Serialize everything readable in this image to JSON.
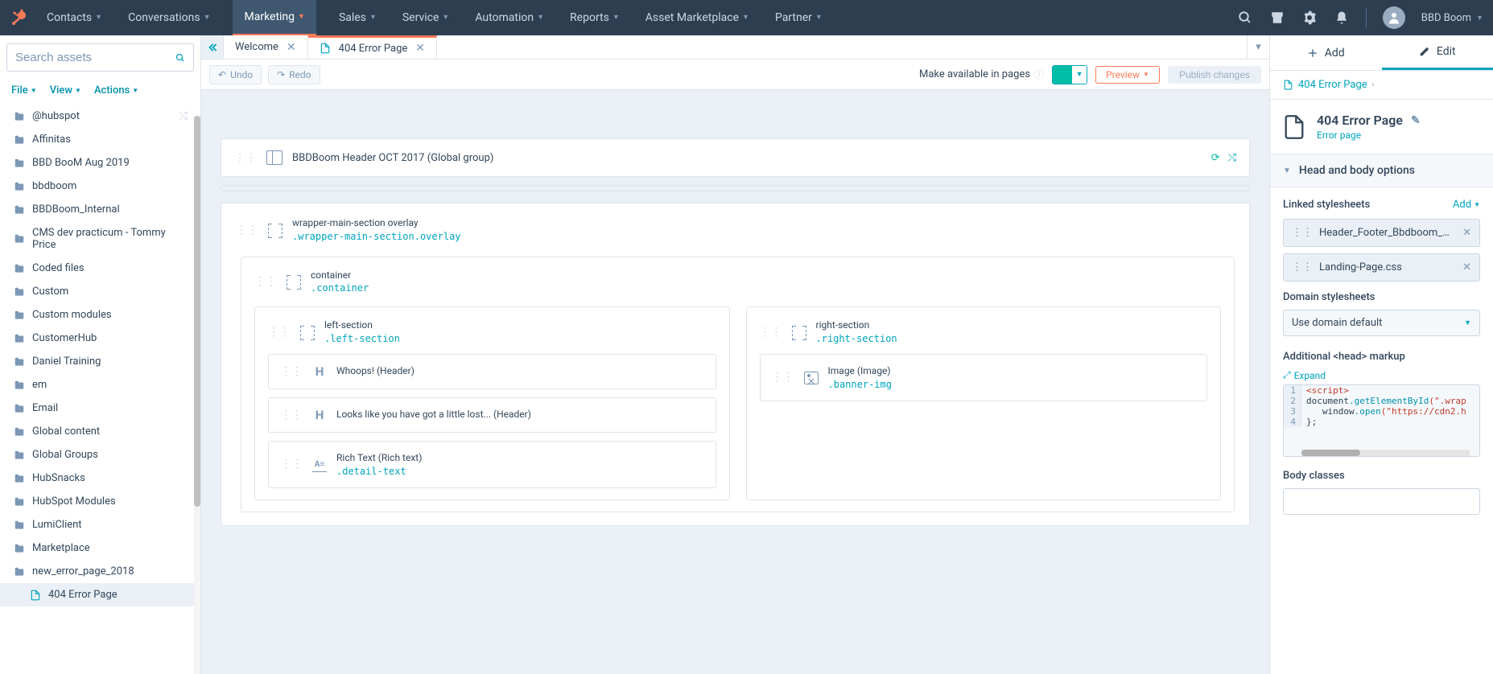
{
  "nav": {
    "items": [
      "Contacts",
      "Conversations",
      "Marketing",
      "Sales",
      "Service",
      "Automation",
      "Reports",
      "Asset Marketplace",
      "Partner"
    ],
    "account": "BBD Boom"
  },
  "sidebar": {
    "search_placeholder": "Search assets",
    "menus": [
      "File",
      "View",
      "Actions"
    ],
    "folders": [
      "@hubspot",
      "Affinitas",
      "BBD BooM Aug 2019",
      "bbdboom",
      "BBDBoom_Internal",
      "CMS dev practicum - Tommy Price",
      "Coded files",
      "Custom",
      "Custom modules",
      "CustomerHub",
      "Daniel Training",
      "em",
      "Email",
      "Global content",
      "Global Groups",
      "HubSnacks",
      "HubSpot Modules",
      "LumiClient",
      "Marketplace",
      "new_error_page_2018"
    ],
    "active_file": "404 Error Page"
  },
  "tabs": [
    {
      "label": "Welcome",
      "file": false
    },
    {
      "label": "404 Error Page",
      "file": true
    }
  ],
  "toolbar": {
    "undo": "Undo",
    "redo": "Redo",
    "make_available": "Make available in pages",
    "preview": "Preview",
    "publish": "Publish changes"
  },
  "canvas": {
    "global_header": "BBDBoom Header OCT 2017 (Global group)",
    "wrapper": {
      "name": "wrapper-main-section overlay",
      "class": ".wrapper-main-section.overlay"
    },
    "container": {
      "name": "container",
      "class": ".container"
    },
    "left_section": {
      "name": "left-section",
      "class": ".left-section",
      "modules": [
        {
          "type": "H",
          "label": "Whoops! (Header)"
        },
        {
          "type": "H",
          "label": "Looks like you have got a little lost... (Header)"
        },
        {
          "type": "richtext",
          "label": "Rich Text (Rich text)",
          "class": ".detail-text"
        }
      ]
    },
    "right_section": {
      "name": "right-section",
      "class": ".right-section",
      "modules": [
        {
          "type": "image",
          "label": "Image (Image)",
          "class": ".banner-img"
        }
      ]
    }
  },
  "right_panel": {
    "tabs": {
      "add": "Add",
      "edit": "Edit"
    },
    "breadcrumb": "404 Error Page",
    "page_title": "404 Error Page",
    "page_subtitle": "Error page",
    "accordion": "Head and body options",
    "linked_stylesheets_label": "Linked stylesheets",
    "add_label": "Add",
    "linked": [
      "Header_Footer_Bbdboom_Oct...",
      "Landing-Page.css"
    ],
    "domain_stylesheets_label": "Domain stylesheets",
    "domain_select": "Use domain default",
    "head_markup_label": "Additional <head> markup",
    "expand": "Expand",
    "code": {
      "1": {
        "tag": "<script>"
      },
      "2": {
        "obj": "document",
        "method": ".getElementById",
        "str": "(\".wrap"
      },
      "3": {
        "obj": "window",
        "method": ".open",
        "str": "(\"https://cdn2.h"
      },
      "4": {
        "text": "};"
      }
    },
    "body_classes_label": "Body classes"
  }
}
